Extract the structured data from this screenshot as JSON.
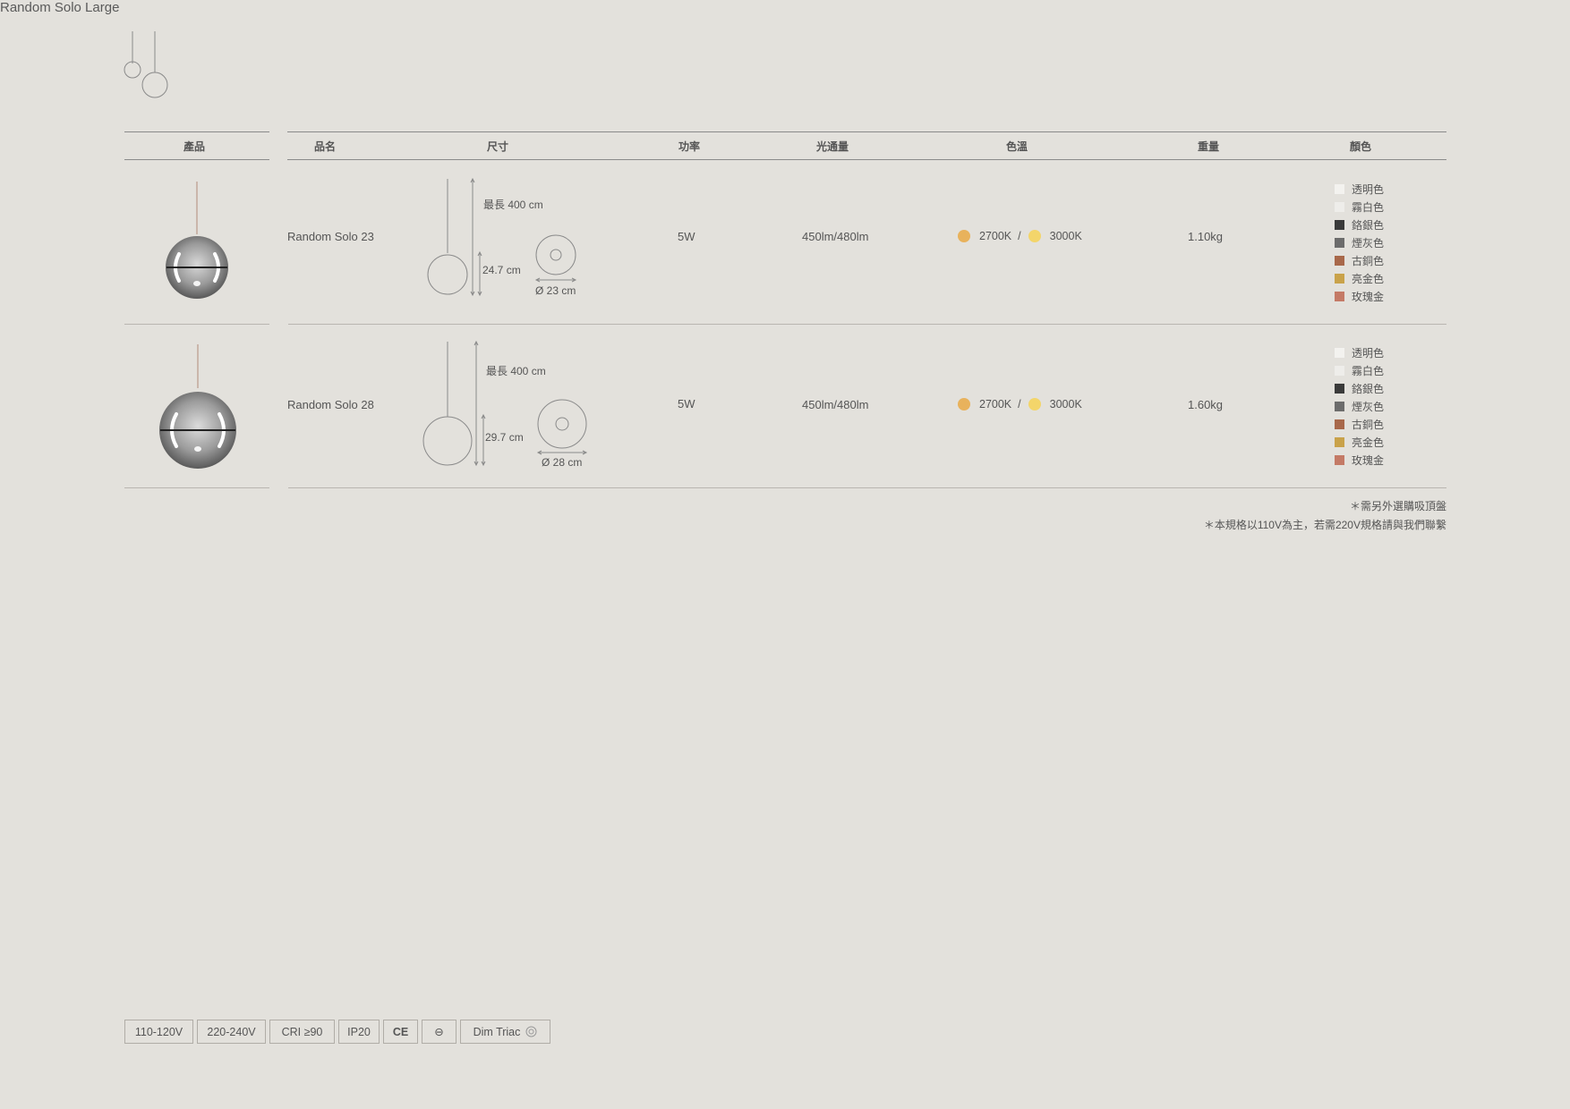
{
  "product_title": "Random Solo Large",
  "headers": {
    "product": "產品",
    "name": "品名",
    "size": "尺寸",
    "power": "功率",
    "lumen": "光通量",
    "color_temp": "色溫",
    "weight": "重量",
    "color": "顏色"
  },
  "rows": [
    {
      "name": "Random Solo 23",
      "max_length": "最長 400 cm",
      "height": "24.7 cm",
      "diameter": "Ø 23 cm",
      "power": "5W",
      "lumen": "450lm/480lm",
      "temp_a": "2700K",
      "temp_sep": "/",
      "temp_b": "3000K",
      "weight": "1.10kg"
    },
    {
      "name": "Random Solo 28",
      "max_length": "最長 400 cm",
      "height": "29.7 cm",
      "diameter": "Ø 28 cm",
      "power": "5W",
      "lumen": "450lm/480lm",
      "temp_a": "2700K",
      "temp_sep": "/",
      "temp_b": "3000K",
      "weight": "1.60kg"
    }
  ],
  "finishes": [
    {
      "label": "透明色",
      "color": "#f3f2ef"
    },
    {
      "label": "霧白色",
      "color": "#eeedea"
    },
    {
      "label": "鉻銀色",
      "color": "#3a3a3a"
    },
    {
      "label": "煙灰色",
      "color": "#6c6c6c"
    },
    {
      "label": "古銅色",
      "color": "#a8684a"
    },
    {
      "label": "亮金色",
      "color": "#c9a24a"
    },
    {
      "label": "玫瑰金",
      "color": "#c47a66"
    }
  ],
  "temp_colors": {
    "warm": "#e8b25c",
    "neutral": "#f3d56a"
  },
  "notes": [
    "＊需另外選購吸頂盤",
    "＊本規格以110V為主，若需220V規格請與我們聯繫"
  ],
  "badges": [
    "110-120V",
    "220-240V",
    "CRI ≥90",
    "IP20",
    "CE",
    "⊖",
    "Dim Triac"
  ]
}
